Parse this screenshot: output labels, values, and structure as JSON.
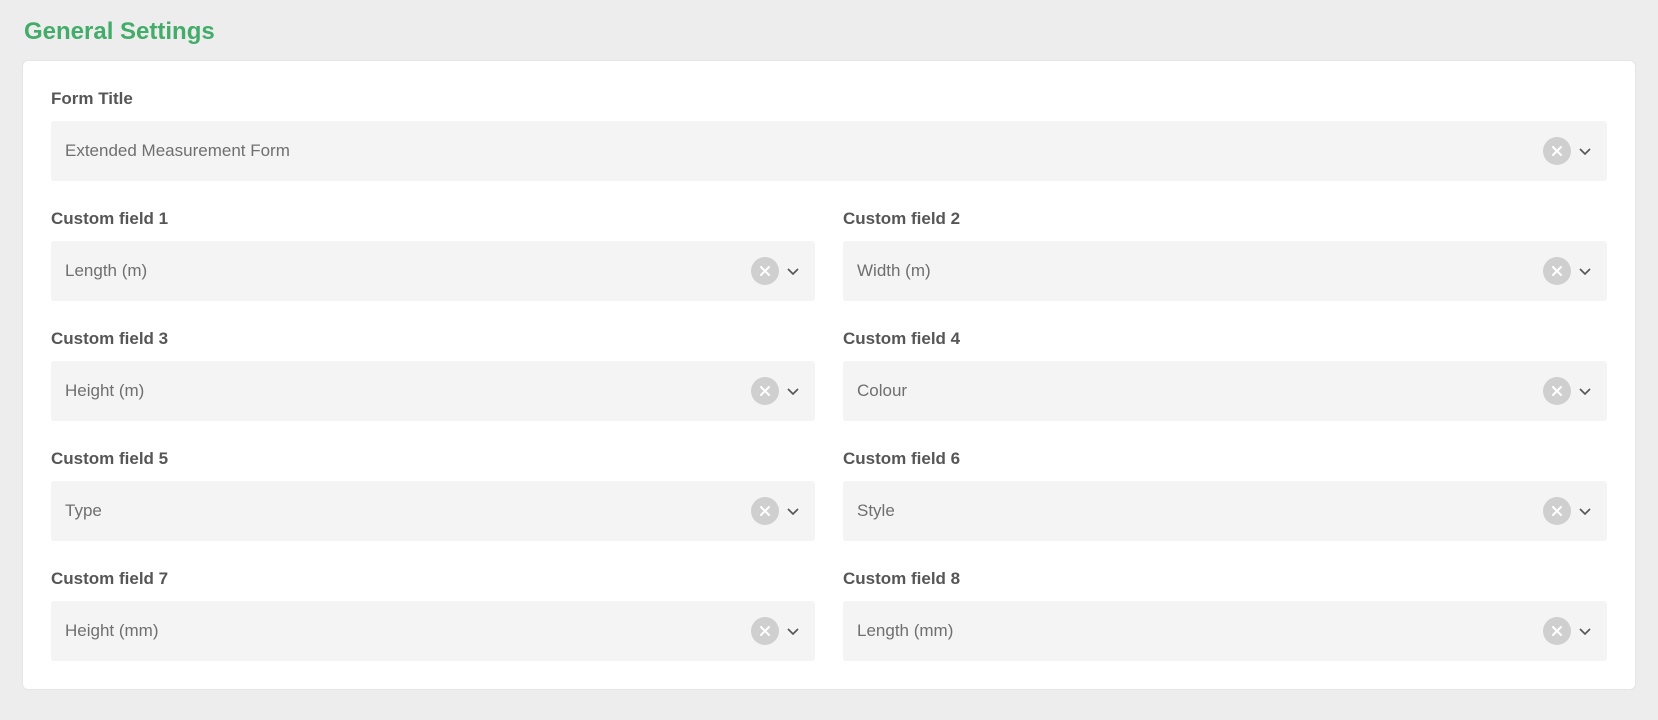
{
  "header": {
    "title": "General Settings"
  },
  "form": {
    "title_label": "Form Title",
    "title_value": "Extended Measurement Form"
  },
  "fields": [
    {
      "label": "Custom field 1",
      "value": "Length (m)"
    },
    {
      "label": "Custom field 2",
      "value": "Width (m)"
    },
    {
      "label": "Custom field 3",
      "value": "Height (m)"
    },
    {
      "label": "Custom field 4",
      "value": "Colour"
    },
    {
      "label": "Custom field 5",
      "value": "Type"
    },
    {
      "label": "Custom field 6",
      "value": "Style"
    },
    {
      "label": "Custom field 7",
      "value": "Height (mm)"
    },
    {
      "label": "Custom field 8",
      "value": "Length (mm)"
    }
  ]
}
